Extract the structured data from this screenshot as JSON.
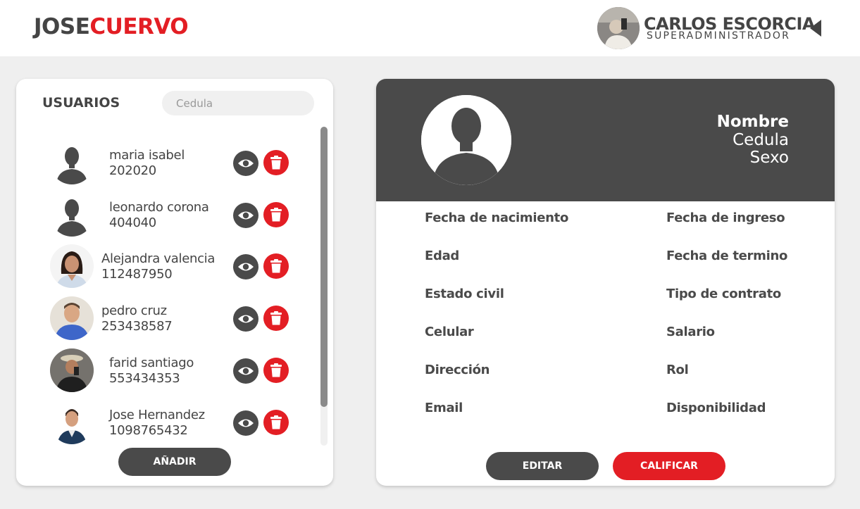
{
  "brand": {
    "part1": "JOSE",
    "part2": "CUERVO",
    "accent_color": "#e31e24"
  },
  "account": {
    "name": "CARLOS ESCORCIA",
    "role": "SUPERADMINISTRADOR"
  },
  "users_panel": {
    "title": "USUARIOS",
    "search_placeholder": "Cedula",
    "add_label": "AÑADIR",
    "items": [
      {
        "name": "maria isabel",
        "cedula": "202020",
        "avatar": "silhouette"
      },
      {
        "name": "leonardo corona",
        "cedula": "404040",
        "avatar": "silhouette"
      },
      {
        "name": "Alejandra valencia",
        "cedula": "112487950",
        "avatar": "photo-woman"
      },
      {
        "name": "pedro cruz",
        "cedula": "253438587",
        "avatar": "photo-man-blue"
      },
      {
        "name": "farid santiago",
        "cedula": "553434353",
        "avatar": "photo-man-hat"
      },
      {
        "name": "Jose Hernandez",
        "cedula": "1098765432",
        "avatar": "photo-man-suit"
      }
    ]
  },
  "profile": {
    "name_label": "Nombre",
    "cedula_label": "Cedula",
    "sex_label": "Sexo",
    "fields_left": [
      "Fecha de nacimiento",
      "Edad",
      "Estado civil",
      "Celular",
      "Dirección",
      "Email"
    ],
    "fields_right": [
      "Fecha de ingreso",
      "Fecha de termino",
      "Tipo de contrato",
      "Salario",
      "Rol",
      "Disponibilidad"
    ],
    "edit_label": "EDITAR",
    "rate_label": "CALIFICAR"
  }
}
